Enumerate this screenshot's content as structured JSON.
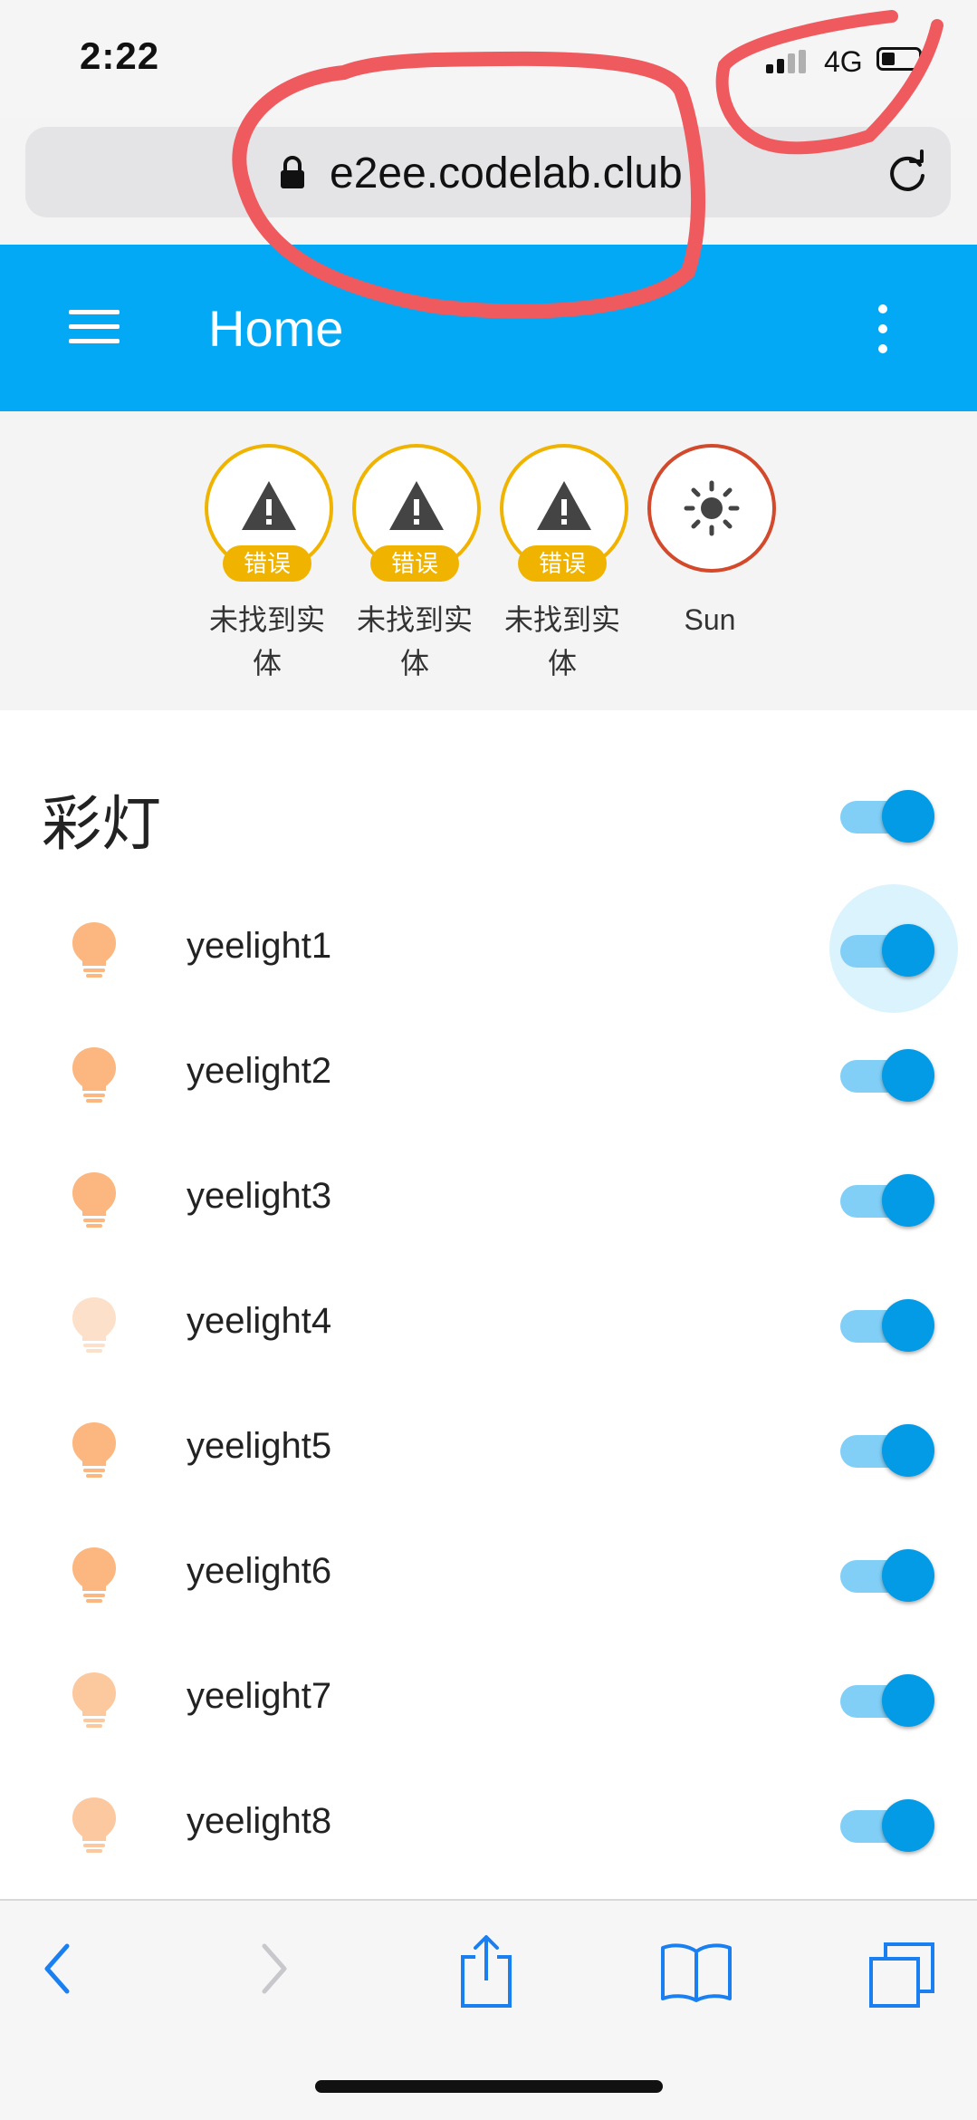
{
  "status_bar": {
    "time": "2:22",
    "network": "4G"
  },
  "browser": {
    "url": "e2ee.codelab.club"
  },
  "header": {
    "title": "Home"
  },
  "badges": [
    {
      "tag": "错误",
      "label_line1": "未找到实",
      "label_line2": "体",
      "icon": "warning-icon"
    },
    {
      "tag": "错误",
      "label_line1": "未找到实",
      "label_line2": "体",
      "icon": "warning-icon"
    },
    {
      "tag": "错误",
      "label_line1": "未找到实",
      "label_line2": "体",
      "icon": "warning-icon"
    },
    {
      "label": "Sun",
      "icon": "sun-icon"
    }
  ],
  "card": {
    "title": "彩灯",
    "master_toggle_on": true,
    "lights": [
      {
        "name": "yeelight1",
        "on": true,
        "icon_color": "#fbb77f"
      },
      {
        "name": "yeelight2",
        "on": true,
        "icon_color": "#fbb77f"
      },
      {
        "name": "yeelight3",
        "on": true,
        "icon_color": "#fbb77f"
      },
      {
        "name": "yeelight4",
        "on": true,
        "icon_color": "#fde0ca"
      },
      {
        "name": "yeelight5",
        "on": true,
        "icon_color": "#fbb77f"
      },
      {
        "name": "yeelight6",
        "on": true,
        "icon_color": "#fbb77f"
      },
      {
        "name": "yeelight7",
        "on": true,
        "icon_color": "#fcc99f"
      },
      {
        "name": "yeelight8",
        "on": true,
        "icon_color": "#fcc8a0"
      }
    ]
  },
  "colors": {
    "primary": "#03a9f4",
    "toggle_thumb": "#039be5",
    "error": "#f0b400",
    "sun_ring": "#d2492b",
    "annotation": "#ef5a5f"
  }
}
